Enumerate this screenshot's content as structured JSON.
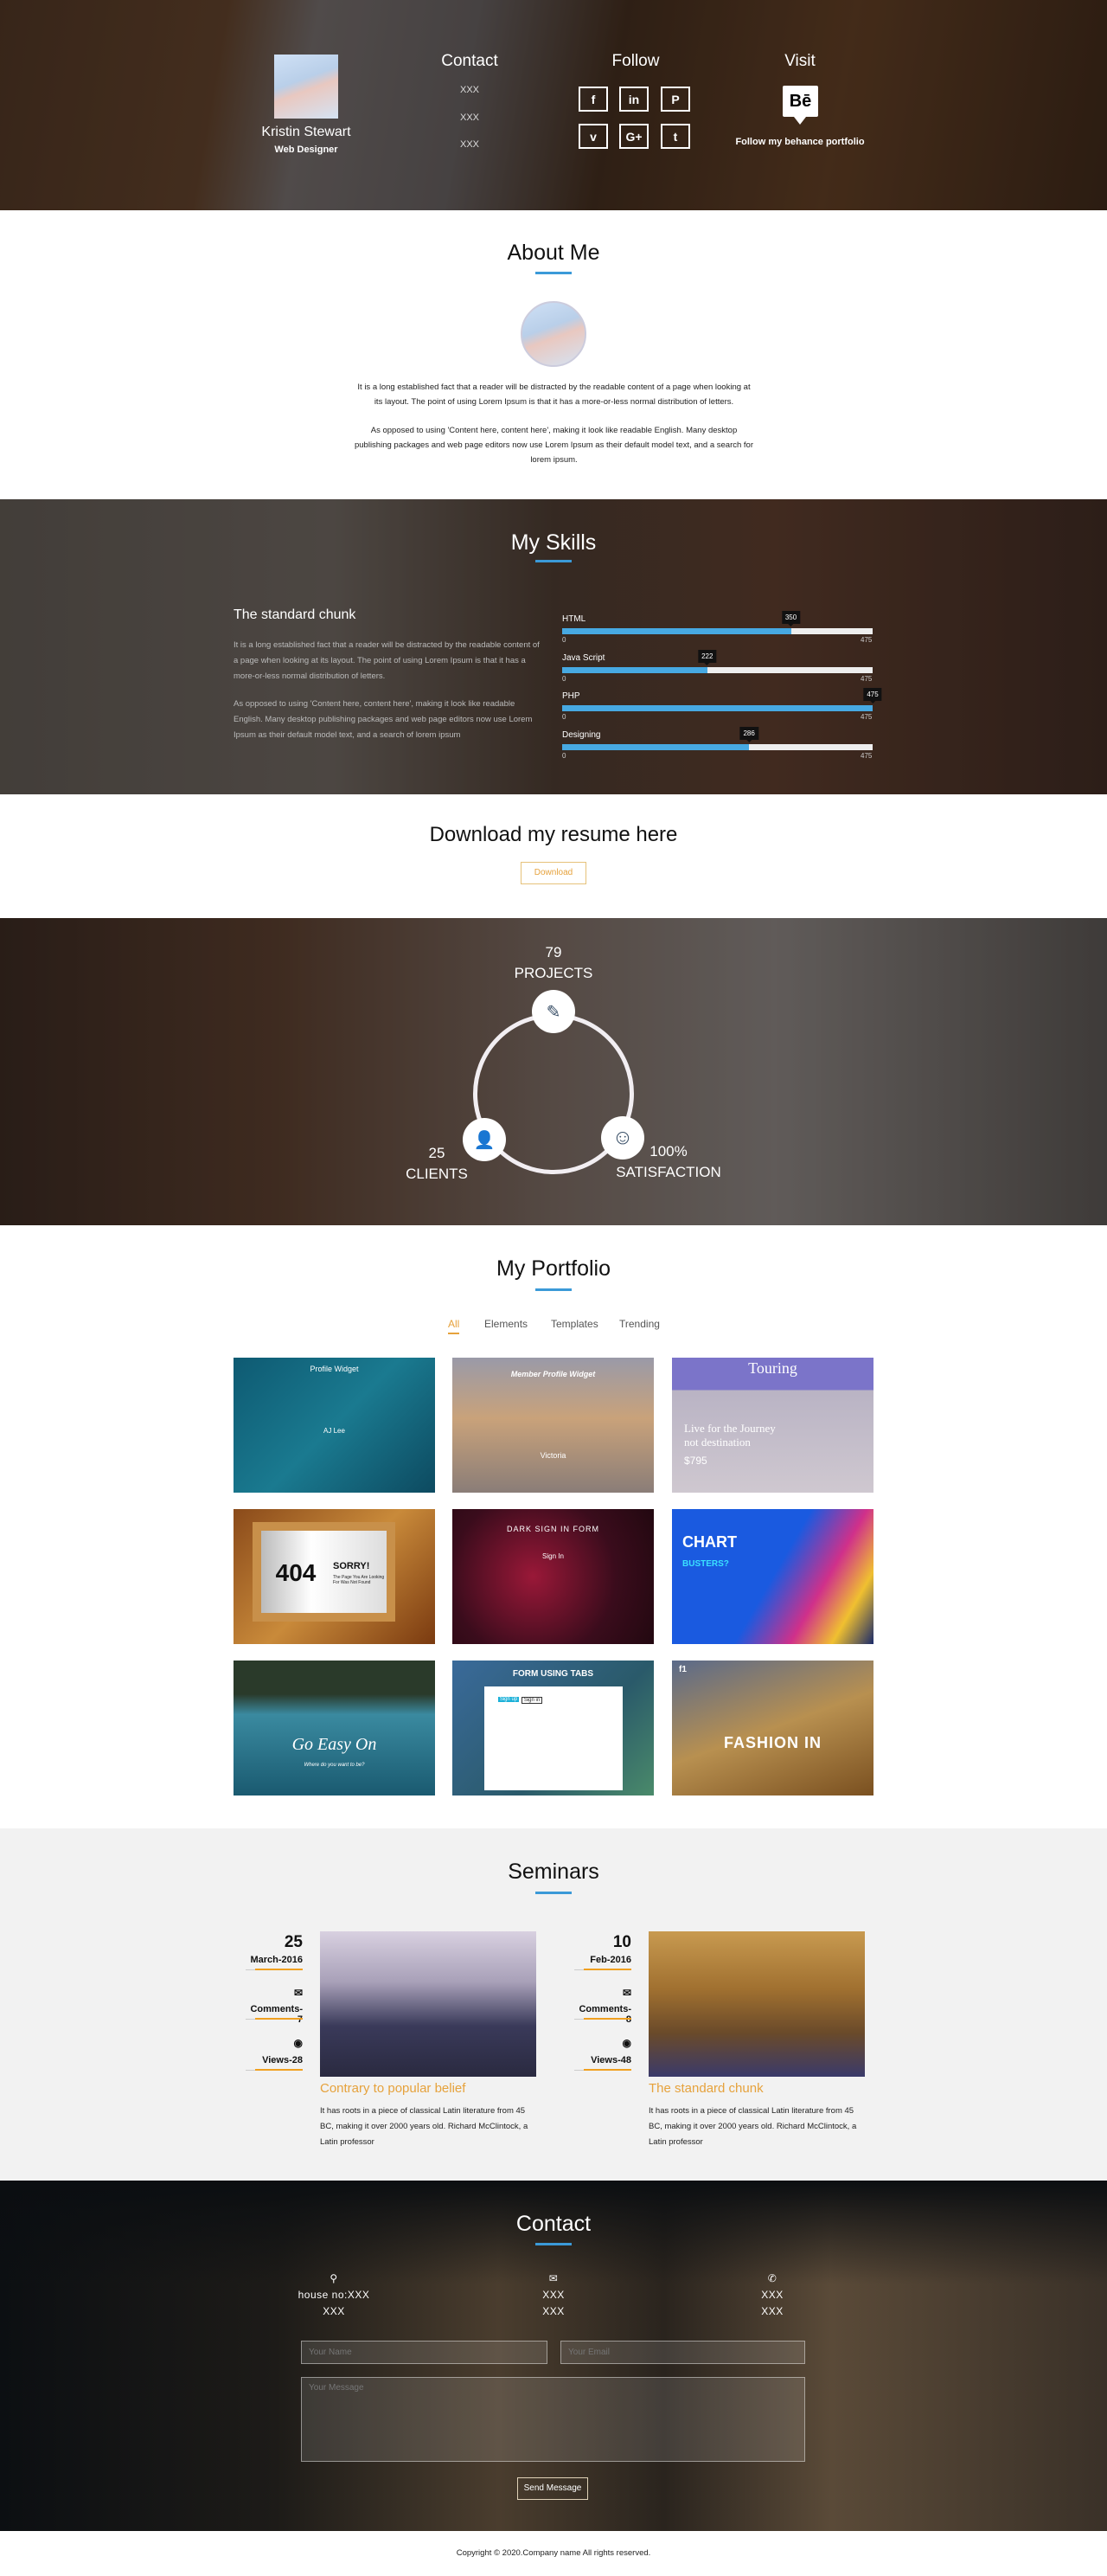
{
  "header": {
    "name": "Kristin Stewart",
    "role": "Web Designer",
    "contact": {
      "title": "Contact",
      "lines": [
        "XXX",
        "XXX",
        "XXX"
      ]
    },
    "follow": {
      "title": "Follow",
      "icons": [
        {
          "name": "facebook-icon",
          "glyph": "f"
        },
        {
          "name": "linkedin-icon",
          "glyph": "in"
        },
        {
          "name": "pinterest-icon",
          "glyph": "P"
        },
        {
          "name": "vimeo-icon",
          "glyph": "v"
        },
        {
          "name": "google-plus-icon",
          "glyph": "G+"
        },
        {
          "name": "tumblr-icon",
          "glyph": "t"
        }
      ]
    },
    "visit": {
      "title": "Visit",
      "logo": "Bē",
      "text": "Follow my behance portfolio"
    }
  },
  "about": {
    "title": "About Me",
    "p1": "It is a long established fact that a reader will be distracted by the readable content of a page when looking at its layout. The point of using Lorem Ipsum is that it has a more-or-less normal distribution of letters.",
    "p2": "As opposed to using 'Content here, content here', making it look like readable English. Many desktop publishing packages and web page editors now use Lorem Ipsum as their default model text, and a search for lorem ipsum."
  },
  "skills": {
    "title": "My Skills",
    "heading": "The standard chunk",
    "p1": "It is a long established fact that a reader will be distracted by the readable content of a page when looking at its layout. The point of using Lorem Ipsum is that it has a more-or-less normal distribution of letters.",
    "p2": "As opposed to using 'Content here, content here', making it look like readable English. Many desktop publishing packages and web page editors now use Lorem Ipsum as their default model text, and a search of lorem ipsum",
    "min": "0",
    "max": "475",
    "accent": "#47a9e2",
    "items": [
      {
        "label": "HTML",
        "value": 350
      },
      {
        "label": "Java Script",
        "value": 222
      },
      {
        "label": "PHP",
        "value": 475
      },
      {
        "label": "Designing",
        "value": 286
      }
    ]
  },
  "resume": {
    "title": "Download my resume here",
    "button": "Download",
    "button_color": "#e6a23c"
  },
  "stats": {
    "projects": {
      "value": "79",
      "label": "PROJECTS"
    },
    "clients": {
      "value": "25",
      "label": "CLIENTS"
    },
    "satisfaction": {
      "value": "100%",
      "label": "SATISFACTION"
    }
  },
  "portfolio": {
    "title": "My Portfolio",
    "tabs": [
      "All",
      "Elements",
      "Templates",
      "Trending"
    ],
    "active_tab": "All",
    "items": [
      {
        "t1": "Profile Widget",
        "t2": "AJ Lee"
      },
      {
        "t1": "Member Profile Widget",
        "t2": "Victoria"
      },
      {
        "t1": "Touring",
        "t2": "Live for the Journey not destination",
        "t3": "$795"
      },
      {
        "t1": "404",
        "t2": "SORRY!",
        "t3": "The Page You Are Looking For Was Not Found"
      },
      {
        "t1": "DARK SIGN IN FORM",
        "t2": "Sign In"
      },
      {
        "t1": "CHART",
        "t2": "BUSTERS?"
      },
      {
        "t1": "Go Easy On",
        "t2": "Where do you want to be?"
      },
      {
        "t1": "FORM USING TABS",
        "t2": "Sign up",
        "t3": "Sign in"
      },
      {
        "t1": "FASHION IN",
        "t2": "f1"
      }
    ]
  },
  "seminars": {
    "title": "Seminars",
    "items": [
      {
        "day": "25",
        "month": "March-2016",
        "comments": "Comments-7",
        "views": "Views-28",
        "title": "Contrary to popular belief",
        "text": "It has roots in a piece of classical Latin literature from 45 BC, making it over 2000 years old. Richard McClintock, a Latin professor"
      },
      {
        "day": "10",
        "month": "Feb-2016",
        "comments": "Comments-8",
        "views": "Views-48",
        "title": "The standard chunk",
        "text": "It has roots in a piece of classical Latin literature from 45 BC, making it over 2000 years old. Richard McClintock, a Latin professor"
      }
    ]
  },
  "contact": {
    "title": "Contact",
    "address": [
      "house no:XXX",
      "XXX"
    ],
    "email": [
      "XXX",
      "XXX"
    ],
    "phone": [
      "XXX",
      "XXX"
    ],
    "name_placeholder": "Your Name",
    "email_placeholder": "Your Email",
    "message_placeholder": "Your Message",
    "send": "Send Message"
  },
  "footer": {
    "copyright": "Copyright © 2020.Company name All rights reserved."
  }
}
